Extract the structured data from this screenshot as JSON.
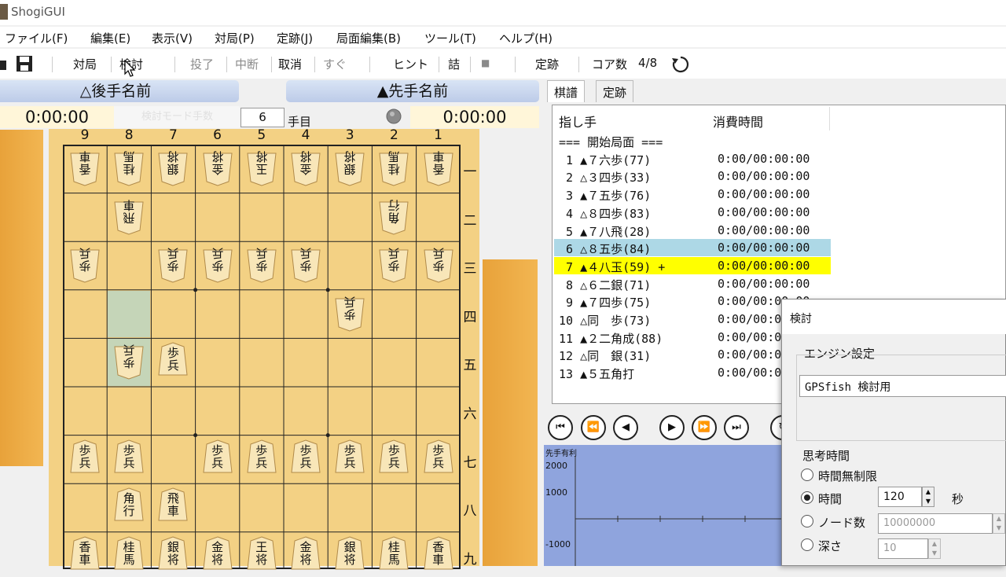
{
  "window": {
    "title": "ShogiGUI"
  },
  "menu": [
    "ファイル(F)",
    "編集(E)",
    "表示(V)",
    "対局(P)",
    "定跡(J)",
    "局面編集(B)",
    "ツール(T)",
    "ヘルプ(H)"
  ],
  "toolbar": {
    "taikyoku": "対局",
    "kento": "検討",
    "toryo": "投了",
    "chudan": "中断",
    "torikeshi": "取消",
    "sugu": "すぐ",
    "hint": "ヒント",
    "tsume": "詰",
    "stop": "■",
    "joseki": "定跡",
    "core": "コア数",
    "core_value": "4/8"
  },
  "players": {
    "gote": "△後手名前",
    "sente": "▲先手名前"
  },
  "clocks": {
    "gote": "0:00:00",
    "sente": "0:00:00"
  },
  "move_counter": {
    "value": "6",
    "suffix": "手目",
    "faded_label": "検討モード手数"
  },
  "board": {
    "col_labels": [
      "9",
      "8",
      "7",
      "6",
      "5",
      "4",
      "3",
      "2",
      "1"
    ],
    "row_labels": [
      "一",
      "二",
      "三",
      "四",
      "五",
      "六",
      "七",
      "八",
      "九"
    ],
    "pieces": [
      {
        "c": 0,
        "r": 0,
        "t": "香\n車",
        "g": true
      },
      {
        "c": 1,
        "r": 0,
        "t": "桂\n馬",
        "g": true
      },
      {
        "c": 2,
        "r": 0,
        "t": "銀\n将",
        "g": true
      },
      {
        "c": 3,
        "r": 0,
        "t": "金\n将",
        "g": true
      },
      {
        "c": 4,
        "r": 0,
        "t": "玉\n将",
        "g": true
      },
      {
        "c": 5,
        "r": 0,
        "t": "金\n将",
        "g": true
      },
      {
        "c": 6,
        "r": 0,
        "t": "銀\n将",
        "g": true
      },
      {
        "c": 7,
        "r": 0,
        "t": "桂\n馬",
        "g": true
      },
      {
        "c": 8,
        "r": 0,
        "t": "香\n車",
        "g": true
      },
      {
        "c": 1,
        "r": 1,
        "t": "飛\n車",
        "g": true
      },
      {
        "c": 7,
        "r": 1,
        "t": "角\n行",
        "g": true
      },
      {
        "c": 0,
        "r": 2,
        "t": "歩\n兵",
        "g": true
      },
      {
        "c": 2,
        "r": 2,
        "t": "歩\n兵",
        "g": true
      },
      {
        "c": 3,
        "r": 2,
        "t": "歩\n兵",
        "g": true
      },
      {
        "c": 4,
        "r": 2,
        "t": "歩\n兵",
        "g": true
      },
      {
        "c": 5,
        "r": 2,
        "t": "歩\n兵",
        "g": true
      },
      {
        "c": 7,
        "r": 2,
        "t": "歩\n兵",
        "g": true
      },
      {
        "c": 8,
        "r": 2,
        "t": "歩\n兵",
        "g": true
      },
      {
        "c": 6,
        "r": 3,
        "t": "歩\n兵",
        "g": true
      },
      {
        "c": 1,
        "r": 4,
        "t": "歩\n兵",
        "g": true
      },
      {
        "c": 2,
        "r": 4,
        "t": "歩\n兵",
        "g": false
      },
      {
        "c": 0,
        "r": 6,
        "t": "歩\n兵",
        "g": false
      },
      {
        "c": 1,
        "r": 6,
        "t": "歩\n兵",
        "g": false
      },
      {
        "c": 3,
        "r": 6,
        "t": "歩\n兵",
        "g": false
      },
      {
        "c": 4,
        "r": 6,
        "t": "歩\n兵",
        "g": false
      },
      {
        "c": 5,
        "r": 6,
        "t": "歩\n兵",
        "g": false
      },
      {
        "c": 6,
        "r": 6,
        "t": "歩\n兵",
        "g": false
      },
      {
        "c": 7,
        "r": 6,
        "t": "歩\n兵",
        "g": false
      },
      {
        "c": 8,
        "r": 6,
        "t": "歩\n兵",
        "g": false
      },
      {
        "c": 1,
        "r": 7,
        "t": "角\n行",
        "g": false
      },
      {
        "c": 2,
        "r": 7,
        "t": "飛\n車",
        "g": false
      },
      {
        "c": 0,
        "r": 8,
        "t": "香\n車",
        "g": false
      },
      {
        "c": 1,
        "r": 8,
        "t": "桂\n馬",
        "g": false
      },
      {
        "c": 2,
        "r": 8,
        "t": "銀\n将",
        "g": false
      },
      {
        "c": 3,
        "r": 8,
        "t": "金\n将",
        "g": false
      },
      {
        "c": 4,
        "r": 8,
        "t": "王\n将",
        "g": false
      },
      {
        "c": 5,
        "r": 8,
        "t": "金\n将",
        "g": false
      },
      {
        "c": 6,
        "r": 8,
        "t": "銀\n将",
        "g": false
      },
      {
        "c": 7,
        "r": 8,
        "t": "桂\n馬",
        "g": false
      },
      {
        "c": 8,
        "r": 8,
        "t": "香\n車",
        "g": false
      }
    ],
    "highlights": [
      {
        "c": 1,
        "r": 3
      },
      {
        "c": 1,
        "r": 4
      }
    ]
  },
  "tabs": [
    "棋譜",
    "定跡"
  ],
  "kifu": {
    "headers": {
      "move": "指し手",
      "time": "消費時間"
    },
    "rows": [
      {
        "move": "=== 開始局面 ===",
        "time": ""
      },
      {
        "move": " 1 ▲７六歩(77)",
        "time": "0:00/00:00:00"
      },
      {
        "move": " 2 △３四歩(33)",
        "time": "0:00/00:00:00"
      },
      {
        "move": " 3 ▲７五歩(76)",
        "time": "0:00/00:00:00"
      },
      {
        "move": " 4 △８四歩(83)",
        "time": "0:00/00:00:00"
      },
      {
        "move": " 5 ▲７八飛(28)",
        "time": "0:00/00:00:00"
      },
      {
        "move": " 6 △８五歩(84)",
        "time": "0:00/00:00:00"
      },
      {
        "move": " 7 ▲４八玉(59) +",
        "time": "0:00/00:00:00"
      },
      {
        "move": " 8 △６二銀(71)",
        "time": "0:00/00:00:00"
      },
      {
        "move": " 9 ▲７四歩(75)",
        "time": "0:00/00:00:00"
      },
      {
        "move": "10 △同　歩(73)",
        "time": "0:00/00:00:00"
      },
      {
        "move": "11 ▲２二角成(88)",
        "time": "0:00/00:00:00"
      },
      {
        "move": "12 △同　銀(31)",
        "time": "0:00/00:00:00"
      },
      {
        "move": "13 ▲５五角打",
        "time": "0:00/00:00:00"
      }
    ]
  },
  "graph": {
    "title": "先手有利",
    "ticks": [
      "2000",
      "1000",
      "-1000"
    ]
  },
  "dialog": {
    "title": "検討",
    "engine_group": "エンジン設定",
    "engine_name": "GPSfish 検討用",
    "think_group": "思考時間",
    "opt_unlimited": "時間無制限",
    "opt_time": "時間",
    "time_value": "120",
    "time_unit": "秒",
    "opt_nodes": "ノード数",
    "nodes_value": "10000000",
    "opt_depth": "深さ",
    "depth_value": "10"
  }
}
